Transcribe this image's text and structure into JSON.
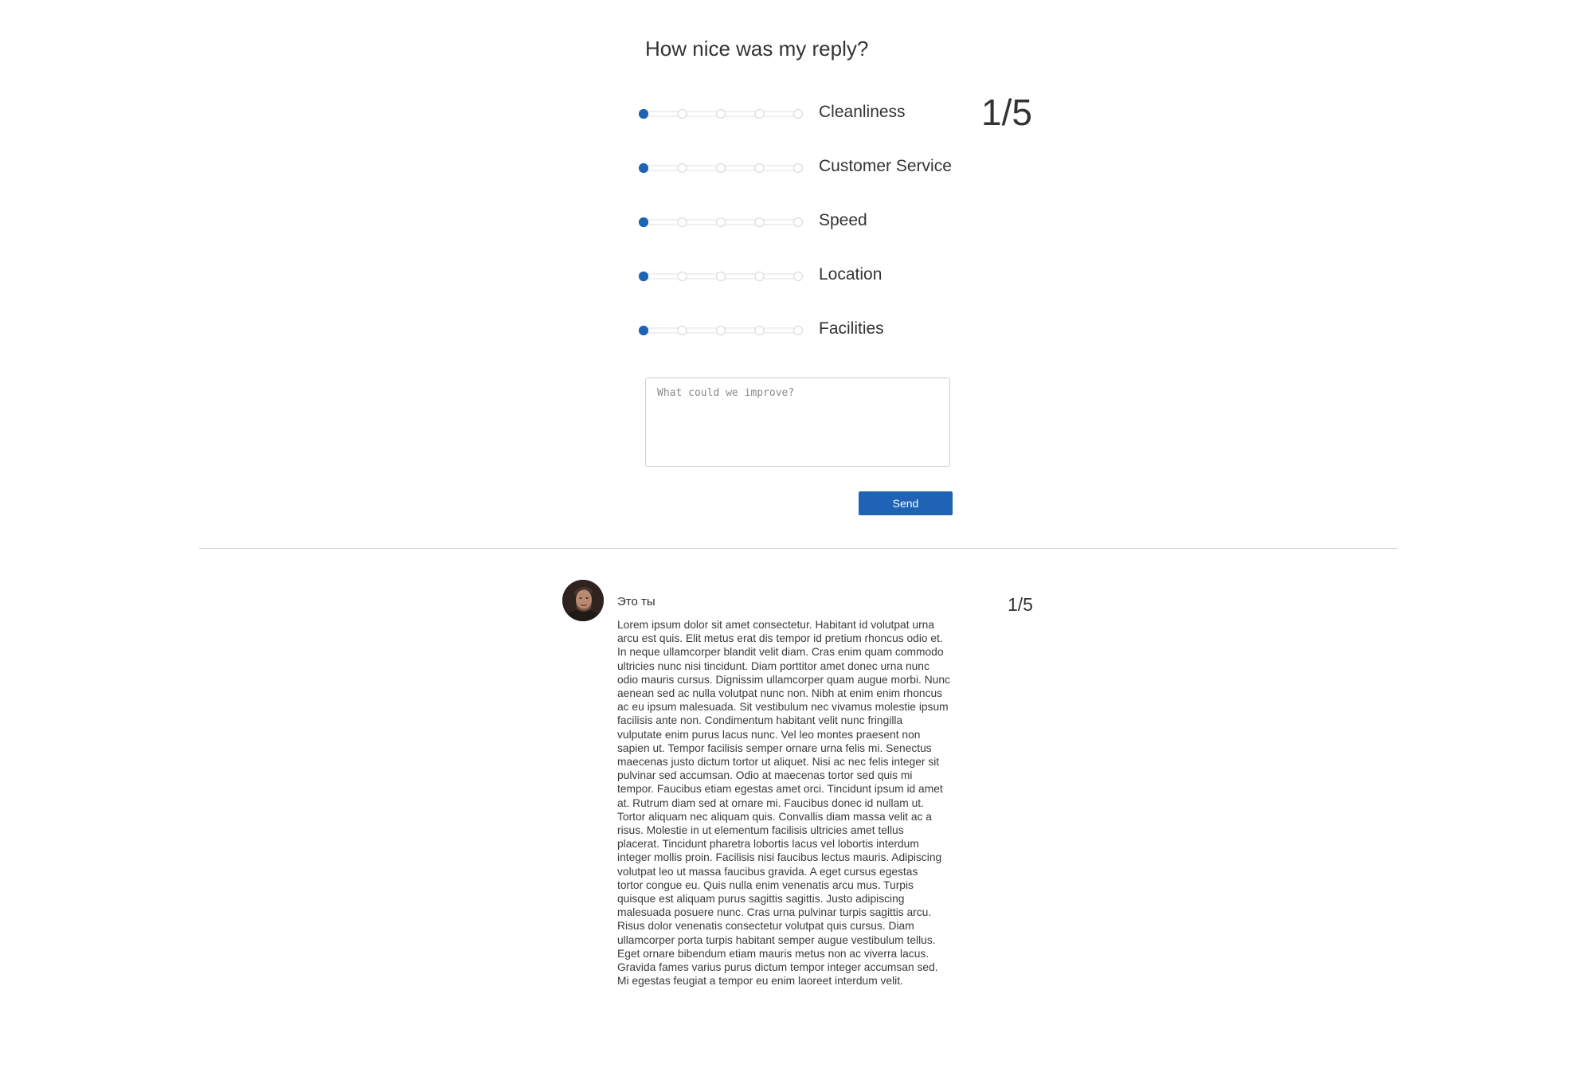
{
  "form": {
    "title": "How nice was my reply?",
    "overall_score": "1/5",
    "ratings": [
      {
        "label": "Cleanliness",
        "value": 1,
        "max": 5
      },
      {
        "label": "Customer Service",
        "value": 1,
        "max": 5
      },
      {
        "label": "Speed",
        "value": 1,
        "max": 5
      },
      {
        "label": "Location",
        "value": 1,
        "max": 5
      },
      {
        "label": "Facilities",
        "value": 1,
        "max": 5
      }
    ],
    "feedback_placeholder": "What could we improve?",
    "feedback_value": "",
    "send_label": "Send"
  },
  "review": {
    "author": "Это ты",
    "score": "1/5",
    "text": "Lorem ipsum dolor sit amet consectetur. Habitant id volutpat urna\narcu est quis. Elit metus erat dis tempor id pretium rhoncus odio et.\nIn neque ullamcorper blandit velit diam. Cras enim quam commodo\nultricies nunc nisi tincidunt. Diam porttitor amet donec urna nunc\nodio mauris cursus. Dignissim ullamcorper quam augue morbi. Nunc\naenean sed ac nulla volutpat nunc non. Nibh at enim enim rhoncus\nac eu ipsum malesuada. Sit vestibulum nec vivamus molestie ipsum\nfacilisis ante non. Condimentum habitant velit nunc fringilla\nvulputate enim purus lacus nunc. Vel leo montes praesent non\nsapien ut. Tempor facilisis semper ornare urna felis mi. Senectus\nmaecenas justo dictum tortor ut aliquet. Nisi ac nec felis integer sit\npulvinar sed accumsan. Odio at maecenas tortor sed quis mi\ntempor. Faucibus etiam egestas amet orci. Tincidunt ipsum id amet\nat. Rutrum diam sed at ornare mi. Faucibus donec id nullam ut.\nTortor aliquam nec aliquam quis. Convallis diam massa velit ac a\nrisus. Molestie in ut elementum facilisis ultricies amet tellus\nplacerat. Tincidunt pharetra lobortis lacus vel lobortis interdum\ninteger mollis proin. Facilisis nisi faucibus lectus mauris. Adipiscing\nvolutpat leo ut massa faucibus gravida. A eget cursus egestas\ntortor congue eu. Quis nulla enim venenatis arcu mus. Turpis\nquisque est aliquam purus sagittis sagittis. Justo adipiscing\nmalesuada posuere nunc. Cras urna pulvinar turpis sagittis arcu.\nRisus dolor venenatis consectetur volutpat quis cursus. Diam\nullamcorper porta turpis habitant semper augue vestibulum tellus.\nEget ornare bibendum etiam mauris metus non ac viverra lacus.\nGravida fames varius purus dictum tempor integer accumsan sed.\nMi egestas feugiat a tempor eu enim laoreet interdum velit."
  },
  "colors": {
    "accent": "#1e63b5",
    "track": "#e6e6e6",
    "divider": "#cfcfcf",
    "text": "#333333"
  }
}
